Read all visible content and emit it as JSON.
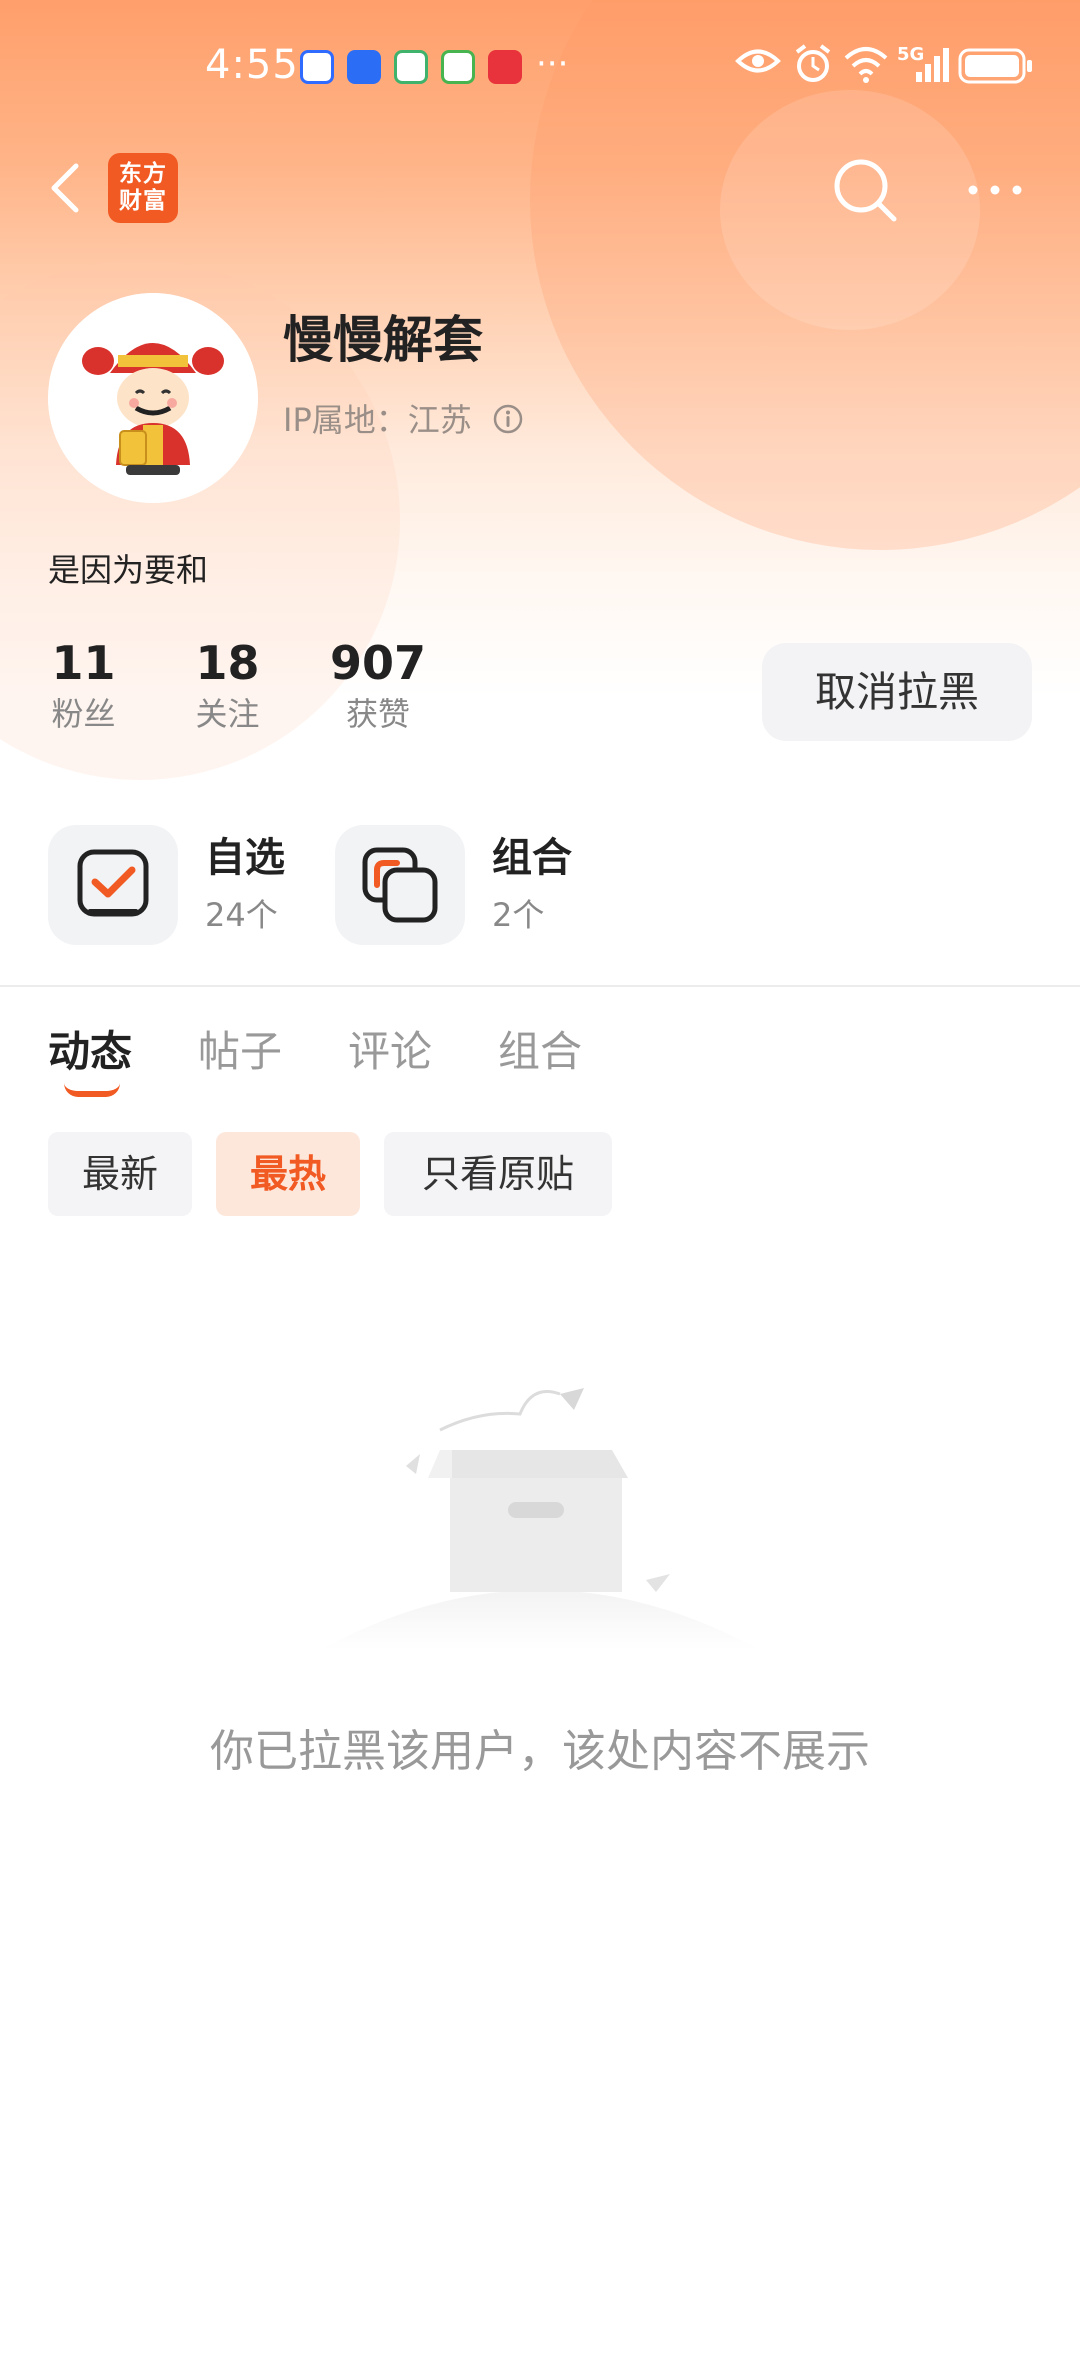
{
  "status_bar": {
    "time": "4:55",
    "more": "···",
    "network": "5G"
  },
  "nav": {
    "logo_line1": "东方",
    "logo_line2": "财富"
  },
  "profile": {
    "name": "慢慢解套",
    "ip_location": "IP属地：江苏",
    "bio": "是因为要和",
    "stats": [
      {
        "value": "11",
        "label": "粉丝"
      },
      {
        "value": "18",
        "label": "关注"
      },
      {
        "value": "907",
        "label": "获赞"
      }
    ],
    "action_button": "取消拉黑"
  },
  "quick_links": [
    {
      "title": "自选",
      "subtitle": "24个",
      "icon": "checkbox-icon"
    },
    {
      "title": "组合",
      "subtitle": "2个",
      "icon": "stack-icon"
    }
  ],
  "tabs": [
    {
      "label": "动态",
      "active": true
    },
    {
      "label": "帖子",
      "active": false
    },
    {
      "label": "评论",
      "active": false
    },
    {
      "label": "组合",
      "active": false
    }
  ],
  "filters": [
    {
      "label": "最新",
      "active": false
    },
    {
      "label": "最热",
      "active": true
    },
    {
      "label": "只看原贴",
      "active": false
    }
  ],
  "empty_state": {
    "message": "你已拉黑该用户，该处内容不展示"
  },
  "colors": {
    "accent": "#f15a22",
    "header_gradient_top": "#ff9f6b"
  }
}
